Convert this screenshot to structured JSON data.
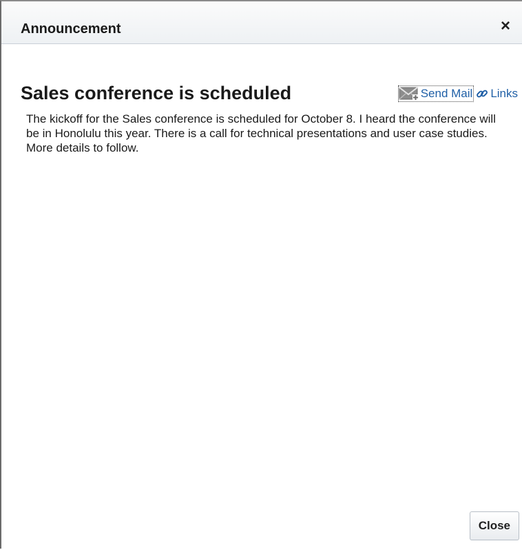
{
  "dialog": {
    "title": "Announcement",
    "close_icon_glyph": "×",
    "heading": "Sales conference is scheduled",
    "actions": {
      "send_mail_label": "Send Mail",
      "links_label": "Links"
    },
    "body": "The kickoff for the Sales conference is scheduled for October 8. I heard the conference will be in Honolulu this year. There is a call for technical presentations and user case studies. More details to follow.",
    "close_button_label": "Close"
  },
  "icons": {
    "close": "close-icon",
    "mail": "mail-icon",
    "link": "link-icon"
  },
  "colors": {
    "link": "#1f5fa6",
    "text": "#1a1a1a",
    "title_bar": "#eef1f4"
  }
}
